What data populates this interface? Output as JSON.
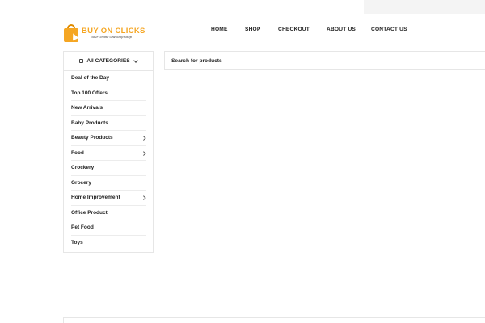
{
  "brand": {
    "name": "BUY ON CLICKS",
    "tagline": "Your Online One Stop Shop",
    "accent_color": "#f5a623"
  },
  "nav": {
    "home": "HOME",
    "shop": "SHOP",
    "checkout": "CHECKOUT",
    "about": "ABOUT US",
    "contact": "CONTACT US"
  },
  "categories": {
    "header_label": "All CATEGORIES",
    "header_icon": "menu-icon",
    "items": [
      {
        "label": "Deal of the Day",
        "has_submenu": false
      },
      {
        "label": "Top 100 Offers",
        "has_submenu": false
      },
      {
        "label": "New Arrivals",
        "has_submenu": false
      },
      {
        "label": "Baby Products",
        "has_submenu": false
      },
      {
        "label": "Beauty Products",
        "has_submenu": true
      },
      {
        "label": "Food",
        "has_submenu": true
      },
      {
        "label": "Crockery",
        "has_submenu": false
      },
      {
        "label": "Grocery",
        "has_submenu": false
      },
      {
        "label": "Home Improvement",
        "has_submenu": true
      },
      {
        "label": "Office Product",
        "has_submenu": false
      },
      {
        "label": "Pet Food",
        "has_submenu": false
      },
      {
        "label": "Toys",
        "has_submenu": false
      }
    ]
  },
  "search": {
    "placeholder": "Search for products",
    "value": ""
  }
}
